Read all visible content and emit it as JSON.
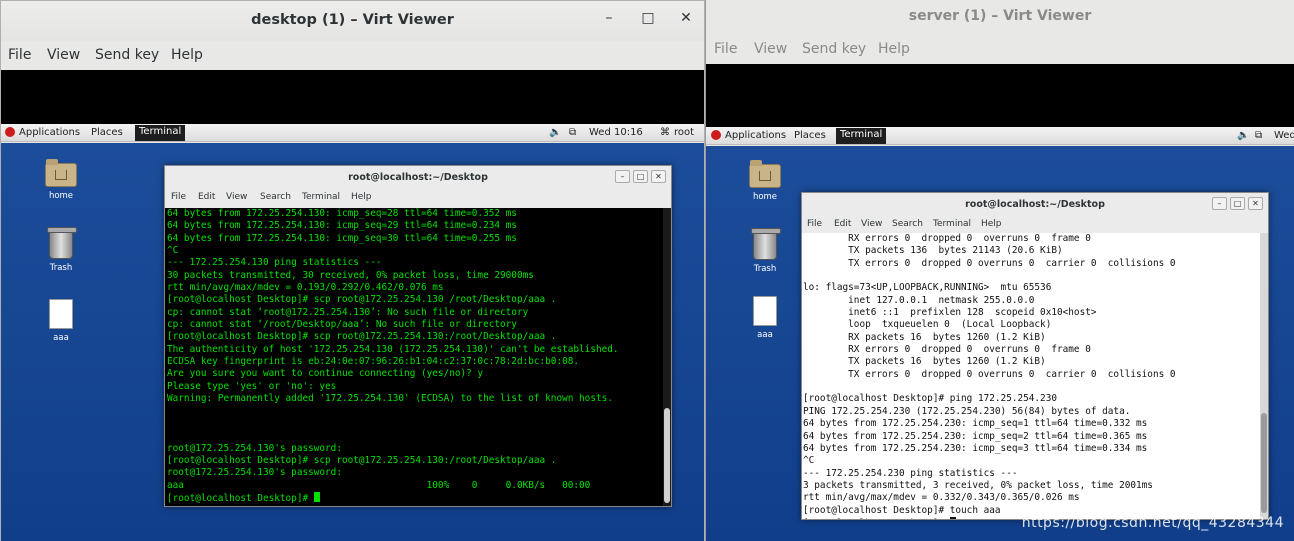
{
  "left_window": {
    "title": "desktop (1) – Virt Viewer",
    "menu": [
      "File",
      "View",
      "Send key",
      "Help"
    ],
    "controls": [
      "–",
      "□",
      "✕"
    ],
    "panel": {
      "applications": "Applications",
      "places": "Places",
      "terminal": "Terminal",
      "clock": "Wed 10:16",
      "user": "root",
      "volume_icon": "🔈",
      "network_icon": "⧉",
      "user_icon": "⌘"
    },
    "desktop_icons": [
      "home",
      "Trash",
      "aaa"
    ],
    "terminal": {
      "title": "root@localhost:~/Desktop",
      "menu": [
        "File",
        "Edit",
        "View",
        "Search",
        "Terminal",
        "Help"
      ],
      "buttons": [
        "–",
        "□",
        "✕"
      ],
      "lines": [
        "64 bytes from 172.25.254.130: icmp_seq=28 ttl=64 time=0.352 ms",
        "64 bytes from 172.25.254.130: icmp_seq=29 ttl=64 time=0.234 ms",
        "64 bytes from 172.25.254.130: icmp_seq=30 ttl=64 time=0.255 ms",
        "^C",
        "--- 172.25.254.130 ping statistics ---",
        "30 packets transmitted, 30 received, 0% packet loss, time 29000ms",
        "rtt min/avg/max/mdev = 0.193/0.292/0.462/0.076 ms",
        "[root@localhost Desktop]# scp root@172.25.254.130 /root/Desktop/aaa .",
        "cp: cannot stat ‘root@172.25.254.130’: No such file or directory",
        "cp: cannot stat ‘/root/Desktop/aaa’: No such file or directory",
        "[root@localhost Desktop]# scp root@172.25.254.130:/root/Desktop/aaa .",
        "The authenticity of host '172.25.254.130 (172.25.254.130)' can't be established.",
        "ECDSA key fingerprint is eb:24:0e:07:96:26:b1:04:c2:37:0c:78:2d:bc:b0:08.",
        "Are you sure you want to continue connecting (yes/no)? y",
        "Please type 'yes' or 'no': yes",
        "Warning: Permanently added '172.25.254.130' (ECDSA) to the list of known hosts.",
        "",
        "",
        "",
        "root@172.25.254.130's password:",
        "[root@localhost Desktop]# scp root@172.25.254.130:/root/Desktop/aaa .",
        "root@172.25.254.130's password:",
        "aaa                                           100%    0     0.0KB/s   00:00",
        "[root@localhost Desktop]# "
      ]
    }
  },
  "right_window": {
    "title": "server (1) – Virt Viewer",
    "menu": [
      "File",
      "View",
      "Send key",
      "Help"
    ],
    "panel": {
      "applications": "Applications",
      "places": "Places",
      "terminal": "Terminal",
      "clock": "Wed",
      "volume_icon": "🔈",
      "network_icon": "⧉"
    },
    "desktop_icons": [
      "home",
      "Trash",
      "aaa"
    ],
    "terminal": {
      "title": "root@localhost:~/Desktop",
      "menu": [
        "File",
        "Edit",
        "View",
        "Search",
        "Terminal",
        "Help"
      ],
      "buttons": [
        "–",
        "□",
        "✕"
      ],
      "lines": [
        "        RX errors 0  dropped 0  overruns 0  frame 0",
        "        TX packets 136  bytes 21143 (20.6 KiB)",
        "        TX errors 0  dropped 0 overruns 0  carrier 0  collisions 0",
        "",
        "lo: flags=73<UP,LOOPBACK,RUNNING>  mtu 65536",
        "        inet 127.0.0.1  netmask 255.0.0.0",
        "        inet6 ::1  prefixlen 128  scopeid 0x10<host>",
        "        loop  txqueuelen 0  (Local Loopback)",
        "        RX packets 16  bytes 1260 (1.2 KiB)",
        "        RX errors 0  dropped 0  overruns 0  frame 0",
        "        TX packets 16  bytes 1260 (1.2 KiB)",
        "        TX errors 0  dropped 0 overruns 0  carrier 0  collisions 0",
        "",
        "[root@localhost Desktop]# ping 172.25.254.230",
        "PING 172.25.254.230 (172.25.254.230) 56(84) bytes of data.",
        "64 bytes from 172.25.254.230: icmp_seq=1 ttl=64 time=0.332 ms",
        "64 bytes from 172.25.254.230: icmp_seq=2 ttl=64 time=0.365 ms",
        "64 bytes from 172.25.254.230: icmp_seq=3 ttl=64 time=0.334 ms",
        "^C",
        "--- 172.25.254.230 ping statistics ---",
        "3 packets transmitted, 3 received, 0% packet loss, time 2001ms",
        "rtt min/avg/max/mdev = 0.332/0.343/0.365/0.026 ms",
        "[root@localhost Desktop]# touch aaa",
        "[root@localhost Desktop]# "
      ]
    }
  },
  "watermark": "https://blog.csdn.net/qq_43284344",
  "colors": {
    "terminal_green": "#00e000",
    "terminal_black_bg": "#000000",
    "terminal_white_bg": "#ffffff",
    "desktop_blue": "#15448f"
  }
}
